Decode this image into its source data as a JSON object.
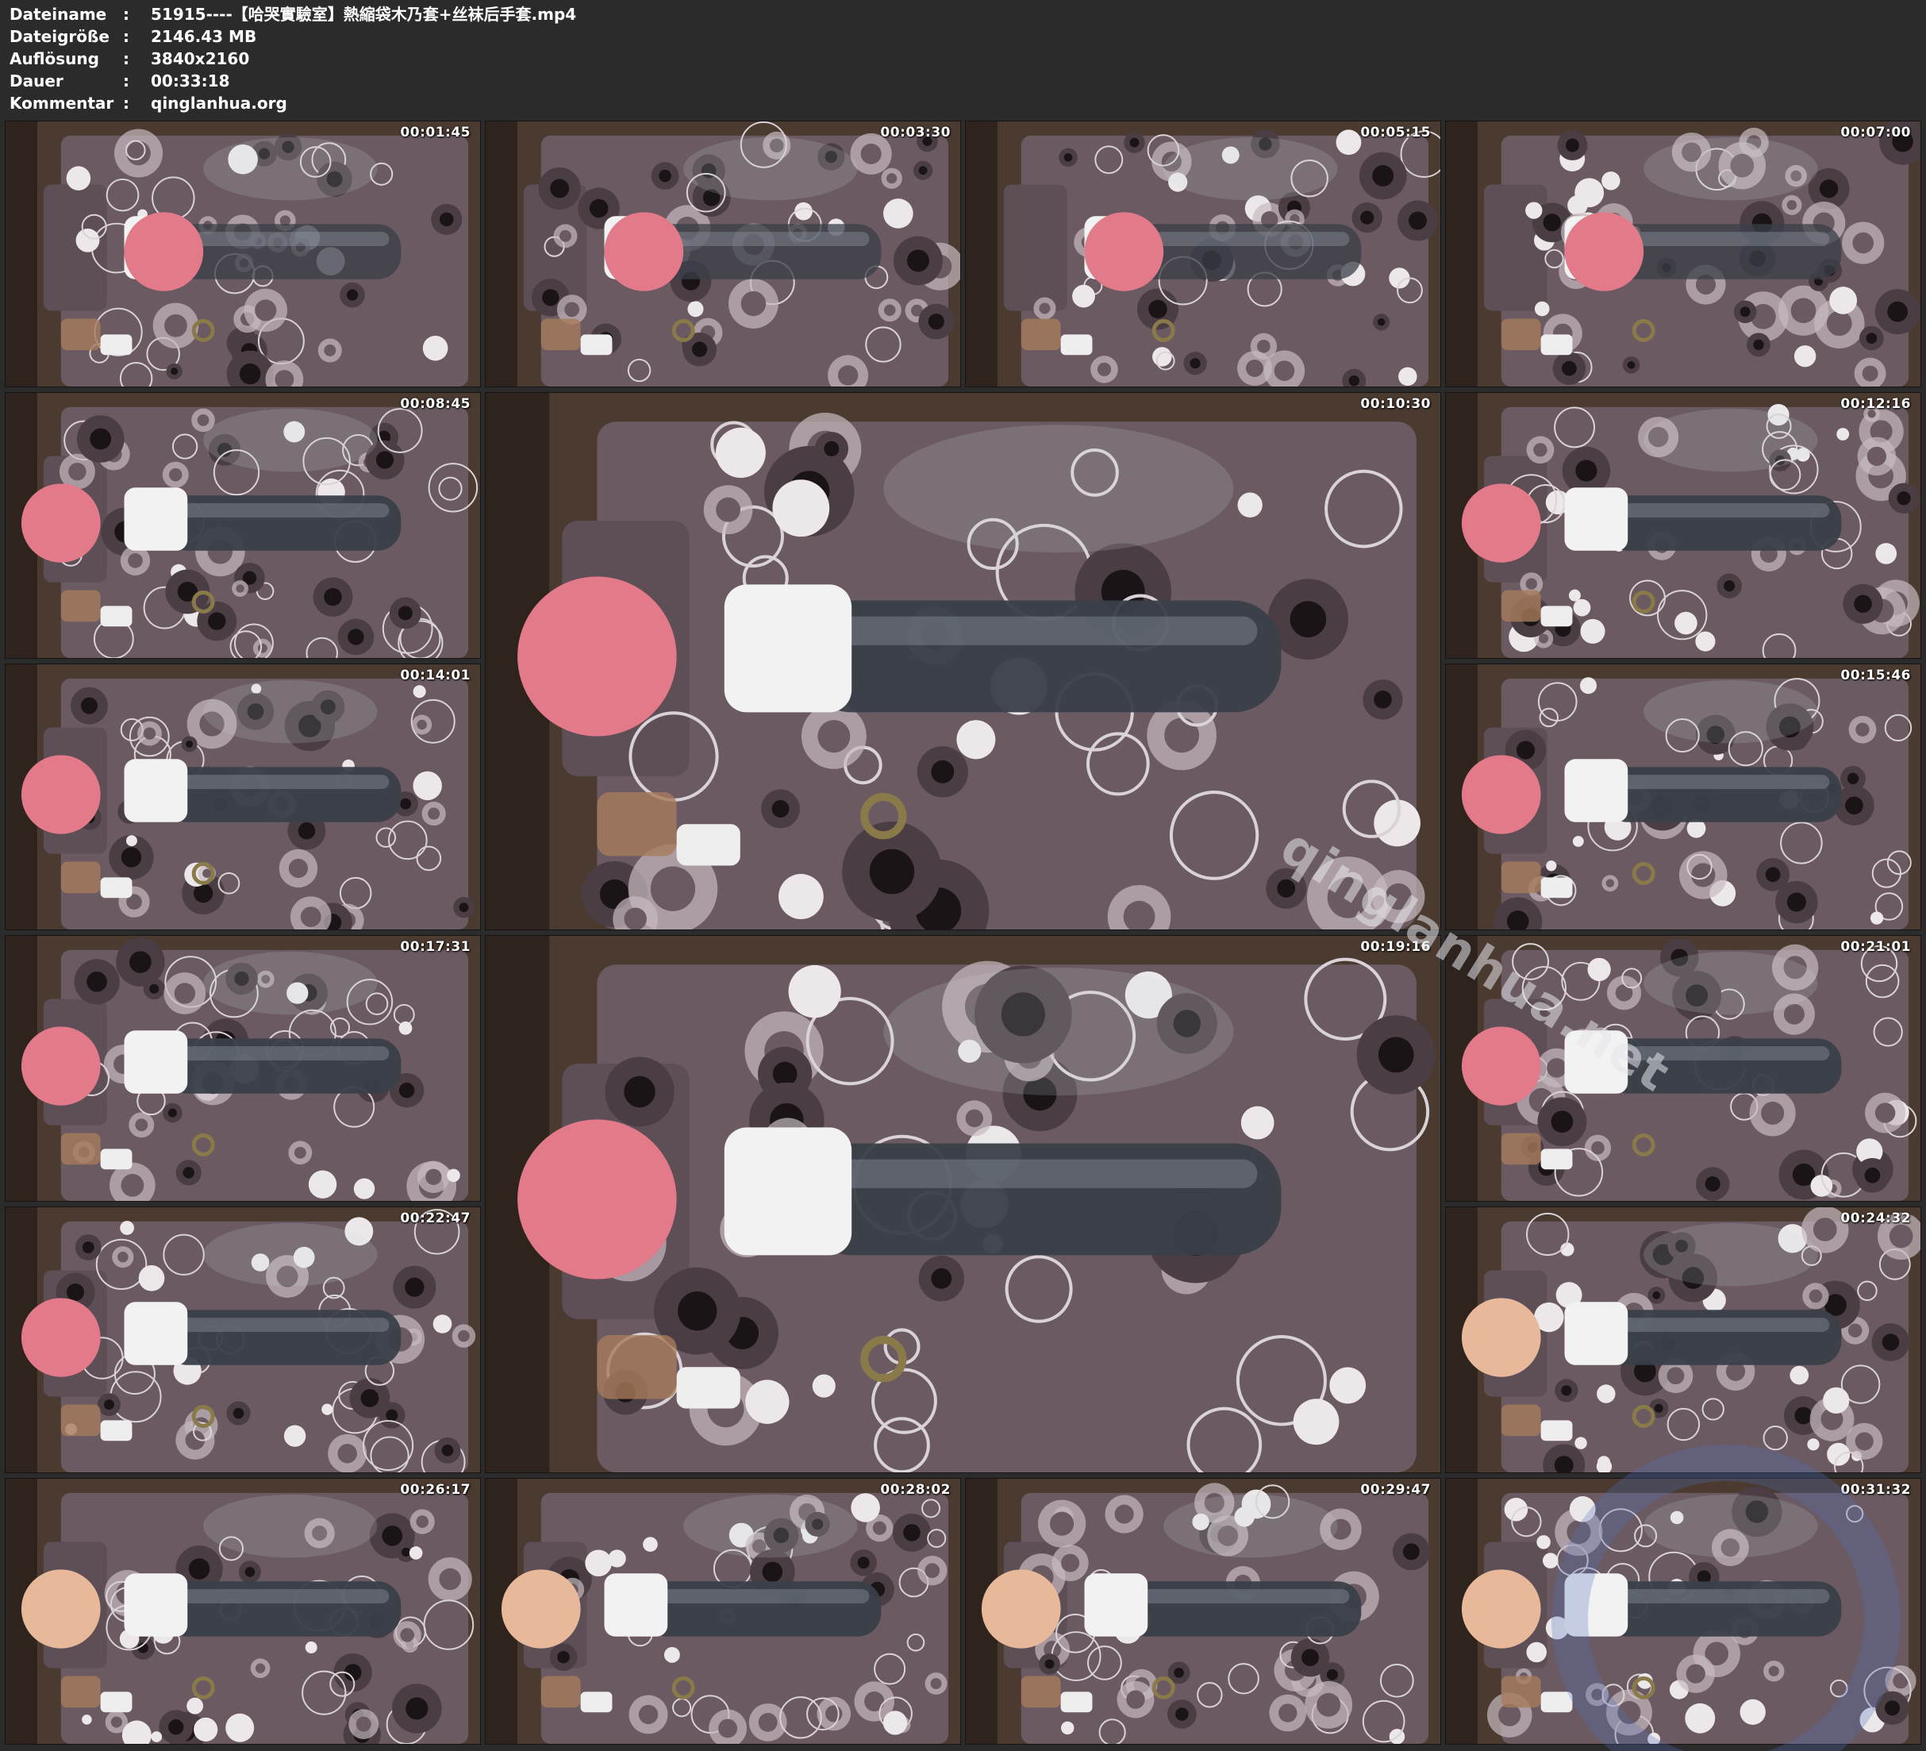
{
  "file_info": {
    "rows": [
      {
        "key": "Dateiname",
        "value": "51915----【哈哭實驗室】熱縮袋木乃套+丝袜后手套.mp4"
      },
      {
        "key": "Dateigröße",
        "value": "2146.43 MB"
      },
      {
        "key": "Auflösung",
        "value": "3840x2160"
      },
      {
        "key": "Dauer",
        "value": "00:33:18"
      },
      {
        "key": "Kommentar",
        "value": "qinglanhua.org"
      }
    ],
    "separator": ":"
  },
  "thumbnails": [
    {
      "timestamp": "00:01:45"
    },
    {
      "timestamp": "00:03:30"
    },
    {
      "timestamp": "00:05:15"
    },
    {
      "timestamp": "00:07:00"
    },
    {
      "timestamp": "00:08:45"
    },
    {
      "timestamp": "00:10:30"
    },
    {
      "timestamp": "00:12:16"
    },
    {
      "timestamp": "00:14:01"
    },
    {
      "timestamp": "00:15:46"
    },
    {
      "timestamp": "00:17:31"
    },
    {
      "timestamp": "00:19:16"
    },
    {
      "timestamp": "00:21:01"
    },
    {
      "timestamp": "00:22:47"
    },
    {
      "timestamp": "00:24:32"
    },
    {
      "timestamp": "00:26:17"
    },
    {
      "timestamp": "00:28:02"
    },
    {
      "timestamp": "00:29:47"
    },
    {
      "timestamp": "00:31:32"
    }
  ],
  "watermark": "qinglanhua.net",
  "colors": {
    "background": "#2b2b2b",
    "bedsheet": "#6b5a62",
    "floor": "#4a3a30",
    "hair": "#e27a8a",
    "wrap": "#3a3f48"
  }
}
